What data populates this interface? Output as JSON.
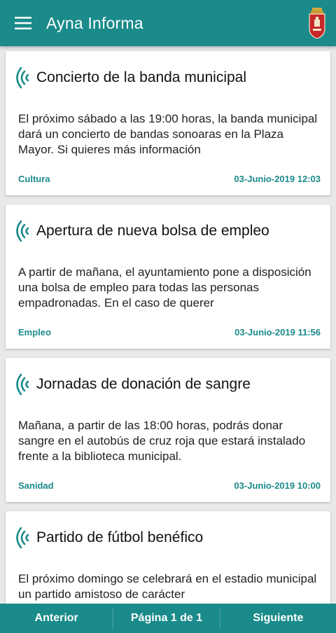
{
  "app": {
    "title": "Ayna Informa",
    "menu_icon": "hamburger-menu-icon",
    "crest_icon": "municipal-crest-icon",
    "accent_color": "#1a8a8a"
  },
  "news": [
    {
      "title": "Concierto de la banda municipal",
      "body": "El próximo sábado a las 19:00 horas, la banda municipal dará un concierto de bandas sonoaras en la Plaza Mayor. Si quieres más información",
      "category": "Cultura",
      "date": "03-Junio-2019 12:03",
      "icon": "broadcast-wave-icon"
    },
    {
      "title": "Apertura de nueva bolsa de empleo",
      "body": "A partir de mañana, el ayuntamiento pone a disposición una bolsa de empleo para todas las personas empadronadas. En el caso de querer",
      "category": "Empleo",
      "date": "03-Junio-2019 11:56",
      "icon": "broadcast-wave-icon"
    },
    {
      "title": "Jornadas de donación de sangre",
      "body": "Mañana, a partir de las 18:00 horas, podrás donar sangre en el autobús de cruz roja que estará instalado frente a la biblioteca municipal.",
      "category": "Sanidad",
      "date": "03-Junio-2019 10:00",
      "icon": "broadcast-wave-icon"
    },
    {
      "title": "Partido de fútbol benéfico",
      "body": "El próximo domingo se celebrará en el estadio municipal un partido amistoso de carácter",
      "category": "",
      "date": "",
      "icon": "broadcast-wave-icon"
    }
  ],
  "pagination": {
    "prev_label": "Anterior",
    "page_label": "Página 1 de 1",
    "next_label": "Siguiente"
  }
}
